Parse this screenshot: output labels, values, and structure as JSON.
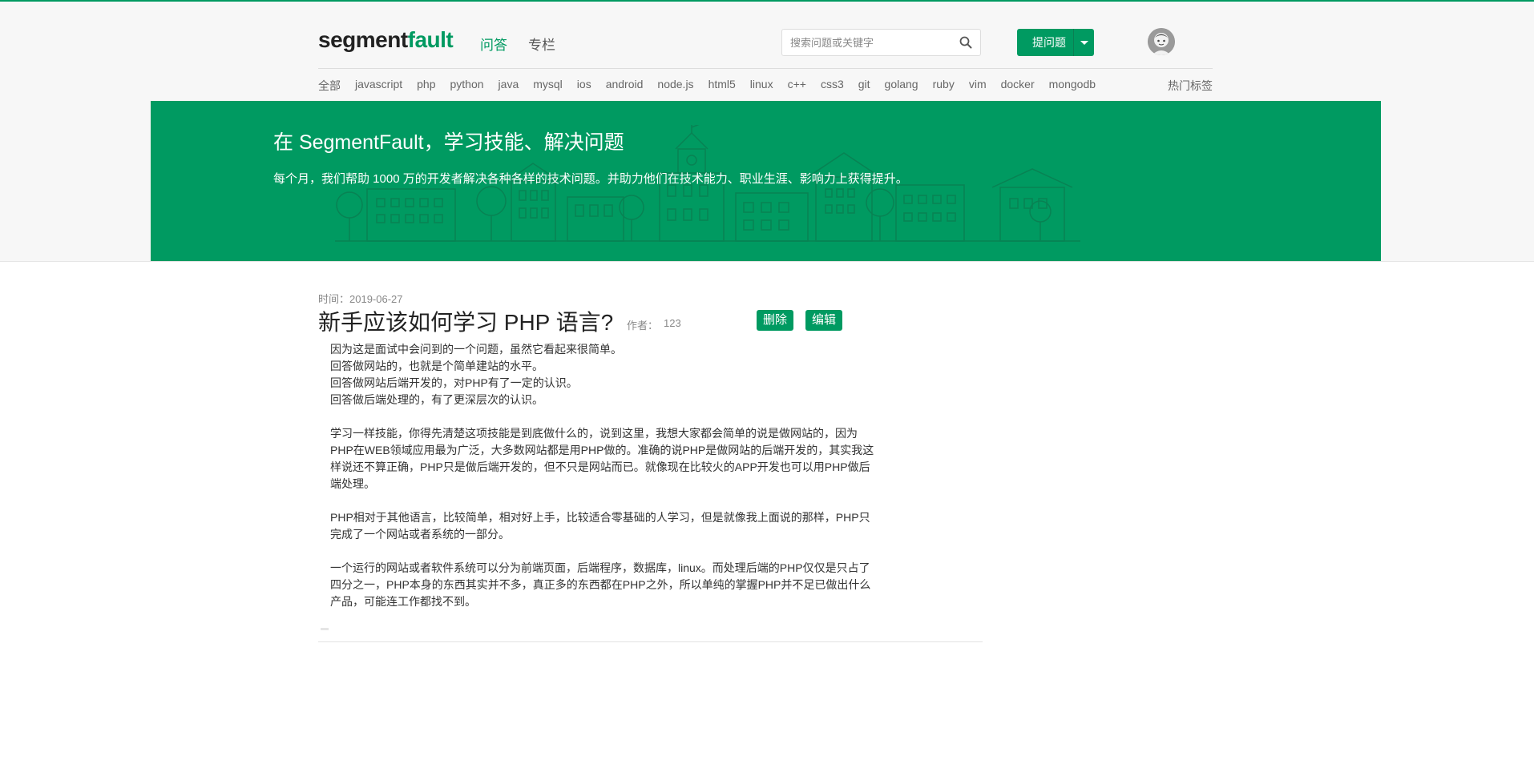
{
  "colors": {
    "brand": "#009a61",
    "header_bg": "#f7f7f7",
    "text": "#333333"
  },
  "header": {
    "logo_main": "segment",
    "logo_accent": "fault",
    "nav": [
      {
        "label": "问答",
        "active": true
      },
      {
        "label": "专栏",
        "active": false
      }
    ],
    "search": {
      "placeholder": "搜索问题或关键字",
      "value": "",
      "icon": "search-icon"
    },
    "ask_button": "提问题",
    "ask_dropdown_icon": "caret-down-icon",
    "avatar_icon": "user-avatar"
  },
  "tags": {
    "items": [
      "全部",
      "javascript",
      "php",
      "python",
      "java",
      "mysql",
      "ios",
      "android",
      "node.js",
      "html5",
      "linux",
      "c++",
      "css3",
      "git",
      "golang",
      "ruby",
      "vim",
      "docker",
      "mongodb"
    ],
    "hot_label": "热门标签"
  },
  "banner": {
    "title": "在 SegmentFault，学习技能、解决问题",
    "subtitle": "每个月，我们帮助 1000 万的开发者解决各种各样的技术问题。并助力他们在技术能力、职业生涯、影响力上获得提升。"
  },
  "post": {
    "time": "时间：2019-06-27",
    "title": "新手应该如何学习 PHP 语言?",
    "author_label": "作者：",
    "author_name": "123",
    "delete_label": "删除",
    "edit_label": "编辑",
    "paragraphs": [
      [
        "因为这是面试中会问到的一个问题，虽然它看起来很简单。",
        "回答做网站的，也就是个简单建站的水平。",
        "回答做网站后端开发的，对PHP有了一定的认识。",
        "回答做后端处理的，有了更深层次的认识。"
      ],
      [
        "学习一样技能，你得先清楚这项技能是到底做什么的，说到这里，我想大家都会简单的说是做网站的，因为",
        "PHP在WEB领域应用最为广泛，大多数网站都是用PHP做的。准确的说PHP是做网站的后端开发的，其实我这",
        "样说还不算正确，PHP只是做后端开发的，但不只是网站而已。就像现在比较火的APP开发也可以用PHP做后",
        "端处理。"
      ],
      [
        "PHP相对于其他语言，比较简单，相对好上手，比较适合零基础的人学习，但是就像我上面说的那样，PHP只",
        "完成了一个网站或者系统的一部分。"
      ],
      [
        "一个运行的网站或者软件系统可以分为前端页面，后端程序，数据库，linux。而处理后端的PHP仅仅是只占了",
        "四分之一，PHP本身的东西其实并不多，真正多的东西都在PHP之外，所以单纯的掌握PHP并不足已做出什么",
        "产品，可能连工作都找不到。"
      ]
    ]
  }
}
